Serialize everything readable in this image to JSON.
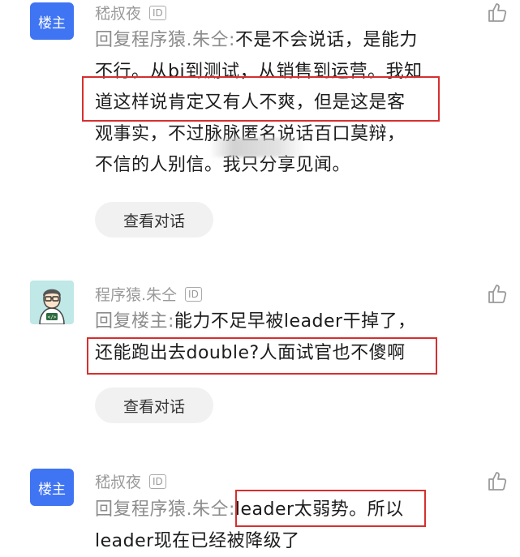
{
  "comments": [
    {
      "avatar_label": "楼主",
      "username": "嵇叔夜",
      "id_badge": "ID",
      "reply_prefix": "回复程序猿.朱仝:",
      "lines": [
        "不是不会说话，是能力",
        "不行。从bi到测试，从销售到运营。我知",
        "道这样说肯定又有人不爽，但是这是客",
        "观事实，不过脉脉匿名说话百口莫辩，",
        "不信的人别信。我只分享见闻。"
      ],
      "view_label": "查看对话"
    },
    {
      "avatar_icon": "programmer-avatar-icon",
      "username": "程序猿.朱仝",
      "id_badge": "ID",
      "reply_prefix": "回复楼主:",
      "lines": [
        "能力不足早被leader干掉了，",
        "还能跑出去double?人面试官也不傻啊"
      ],
      "view_label": "查看对话"
    },
    {
      "avatar_label": "楼主",
      "username": "嵇叔夜",
      "id_badge": "ID",
      "reply_prefix": "回复程序猿.朱仝:",
      "lines": [
        "leader太弱势。所以",
        "leader现在已经被降级了"
      ]
    }
  ],
  "colors": {
    "accent": "#3f74f3",
    "highlight_box": "#d62f2f"
  }
}
